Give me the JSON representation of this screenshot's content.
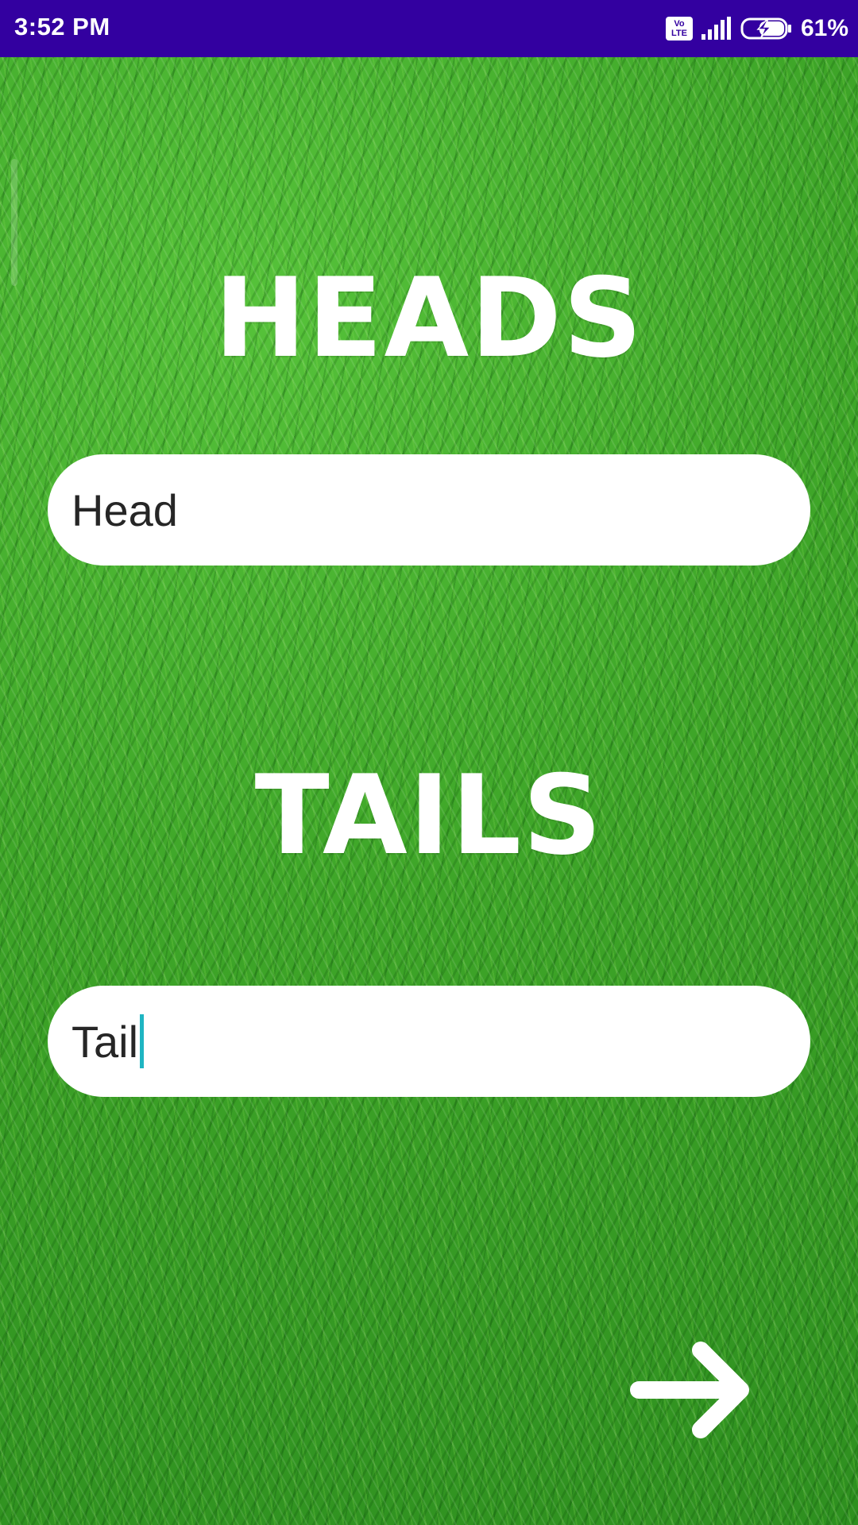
{
  "status_bar": {
    "time": "3:52 PM",
    "volte_label": "Vo LTE",
    "battery_percent": "61%",
    "icons": [
      "volte-icon",
      "signal-icon",
      "battery-charging-icon"
    ]
  },
  "heads": {
    "title": "HEADS",
    "input_value": "Head"
  },
  "tails": {
    "title": "TAILS",
    "input_value": "Tail"
  },
  "navigation": {
    "next_icon": "arrow-right-icon"
  },
  "colors": {
    "status_bar": "#3300a0",
    "background_grass": "#3ea528",
    "title_text": "#ffffff",
    "field_background": "#ffffff",
    "caret": "#1fb5c2"
  }
}
